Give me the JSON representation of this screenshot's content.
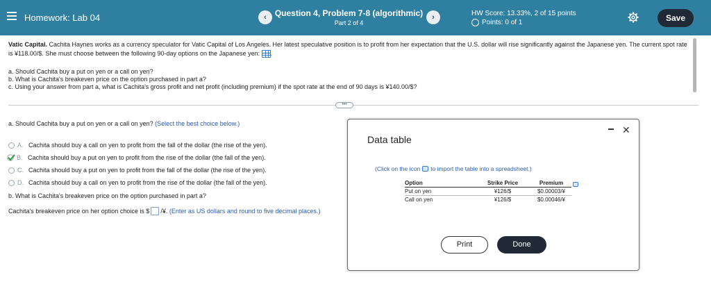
{
  "header": {
    "hw_title": "Homework:  Lab 04",
    "nav_prev": "‹",
    "nav_next": "›",
    "question_title": "Question 4, Problem 7-8 (algorithmic)",
    "question_part": "Part 2 of 4",
    "hw_score": "HW Score: 13.33%, 2 of 15 points",
    "points": "Points: 0 of 1",
    "save_label": "Save",
    "bar_color": "#2f7fa1"
  },
  "problem": {
    "company": "Vatic Capital.",
    "text": " Cachita Haynes works as a currency speculator for Vatic Capital of Los Angeles. Her latest speculative position is to profit from her expectation that the U.S. dollar will rise significantly against the Japanese yen. The current spot rate is ¥118.00/$. She must choose between the following 90-day options on the Japanese yen: ",
    "text_end": ".",
    "q_a": "a. Should Cachita buy a put on yen or a call on yen?",
    "q_b": "b. What is Cachita's breakeven price on the option purchased in part a?",
    "q_c": "c. Using your answer from part a, what is Cachita's gross profit and net profit (including premium) if the spot rate at the end of 90 days is ¥140.00/$?"
  },
  "divider_handle": "•••",
  "part_a": {
    "prompt": "a. Should Cachita buy a put on yen or a call on yen?",
    "hint": "(Select the best choice below.)",
    "choices": [
      {
        "letter": "A.",
        "text": "Cachita should buy a call on yen to profit from the fall of the dollar (the rise of the yen)."
      },
      {
        "letter": "B.",
        "text": "Cachita should buy a put on yen to profit from the rise of the dollar (the fall of the yen)."
      },
      {
        "letter": "C.",
        "text": "Cachita should buy a put on yen to profit from the fall of the dollar (the rise of the yen)."
      },
      {
        "letter": "D.",
        "text": "Cachita should buy a call on yen to profit from the rise of the dollar (the fall of the yen)."
      }
    ],
    "selected": "B"
  },
  "part_b": {
    "prompt": "b. What is Cachita's breakeven price on the option purchased in part a?",
    "answer_prefix": "Cachita's breakeven price on her option choice is $",
    "answer_value": "",
    "answer_suffix": "/¥.",
    "hint": "(Enter as US dollars and round to five decimal places.)"
  },
  "modal": {
    "title": "Data table",
    "import_pre": "(Click on the icon",
    "import_post": "to import the table into a spreadsheet.)",
    "columns": [
      "Option",
      "Strike Price",
      "Premium"
    ],
    "rows": [
      [
        "Put on yen",
        "¥126/$",
        "$0.00003/¥"
      ],
      [
        "Call on yen",
        "¥126/$",
        "$0.00046/¥"
      ]
    ],
    "print_label": "Print",
    "done_label": "Done"
  }
}
